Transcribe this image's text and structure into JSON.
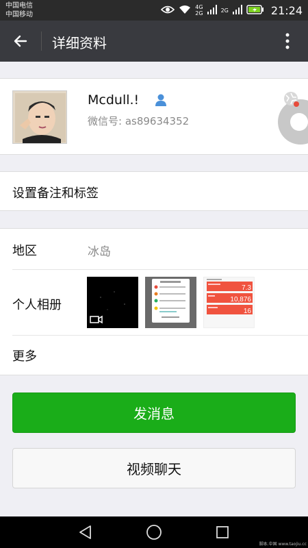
{
  "status_bar": {
    "carrier_1": "中国电信",
    "carrier_2": "中国移动",
    "net_1_top": "4G",
    "net_1_bottom": "2G",
    "net_2": "2G",
    "time": "21:24",
    "battery_color": "#7ed321"
  },
  "app_bar": {
    "title": "详细资料",
    "background": "#393a3f"
  },
  "profile": {
    "nickname": "Mcdull.!",
    "wechat_id": "微信号: as89634352"
  },
  "remark": {
    "label": "设置备注和标签"
  },
  "info": {
    "region_label": "地区",
    "region_value": "冰岛",
    "album_label": "个人相册",
    "more_label": "更多"
  },
  "album_stats": {
    "value_1": "7.3",
    "value_2": "10,876",
    "value_3": "16"
  },
  "actions": {
    "send_message": "发消息",
    "video_chat": "视频聊天",
    "primary_color": "#1aad19"
  },
  "watermark": "脚本.中国 www.taojiu.cc"
}
